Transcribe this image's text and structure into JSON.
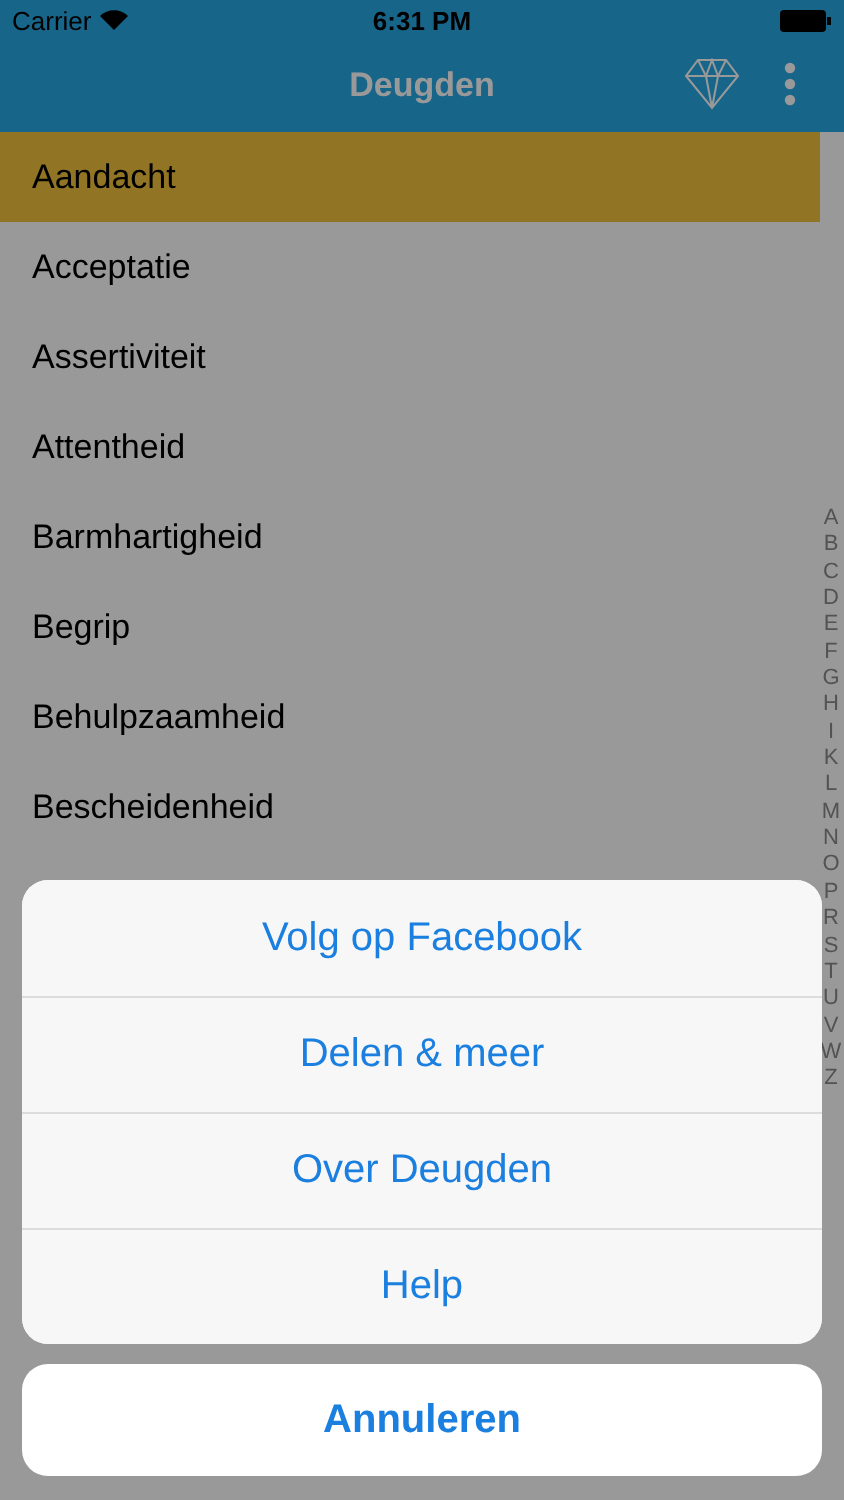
{
  "status_bar": {
    "carrier": "Carrier",
    "time": "6:31 PM"
  },
  "nav_bar": {
    "title": "Deugden"
  },
  "list": {
    "rows": [
      {
        "label": "Aandacht",
        "selected": true
      },
      {
        "label": "Acceptatie",
        "selected": false
      },
      {
        "label": "Assertiviteit",
        "selected": false
      },
      {
        "label": "Attentheid",
        "selected": false
      },
      {
        "label": "Barmhartigheid",
        "selected": false
      },
      {
        "label": "Begrip",
        "selected": false
      },
      {
        "label": "Behulpzaamheid",
        "selected": false
      },
      {
        "label": "Bescheidenheid",
        "selected": false
      }
    ]
  },
  "index": [
    "A",
    "B",
    "C",
    "D",
    "E",
    "F",
    "G",
    "H",
    "I",
    "K",
    "L",
    "M",
    "N",
    "O",
    "P",
    "R",
    "S",
    "T",
    "U",
    "V",
    "W",
    "Z"
  ],
  "action_sheet": {
    "actions": [
      "Volg op Facebook",
      "Delen & meer",
      "Over Deugden",
      "Help"
    ],
    "cancel": "Annuleren"
  }
}
